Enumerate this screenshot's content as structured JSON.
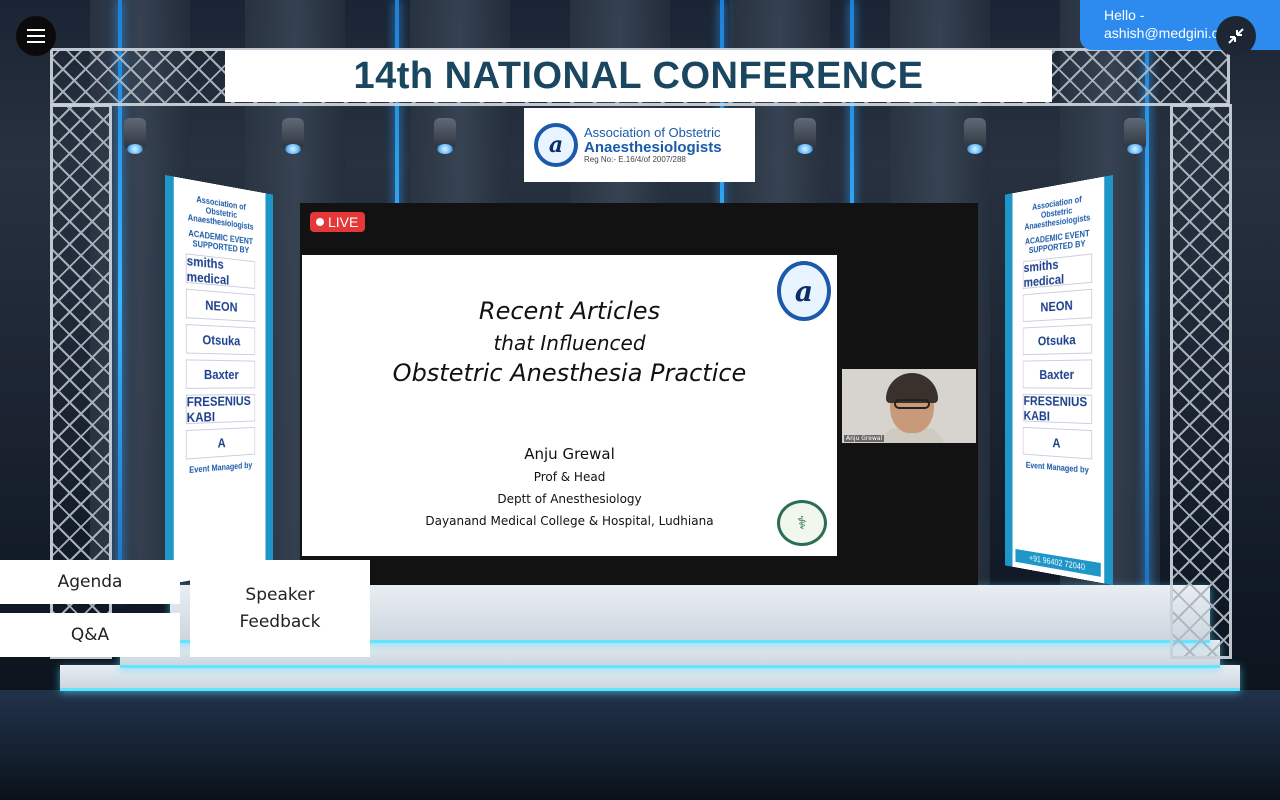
{
  "header": {
    "greeting": "Hello -",
    "email": "ashish@medgini.com"
  },
  "stage": {
    "banner_title": "14th NATIONAL CONFERENCE",
    "association": {
      "line1": "Association of Obstetric",
      "line2": "Anaesthesiologists",
      "line3": "Reg No:- E.16/4/of 2007/288",
      "logo_letter": "a"
    }
  },
  "sponsors": {
    "left": {
      "top_text": "Association of Obstetric Anaesthesiologists",
      "subtitle": "ACADEMIC EVENT SUPPORTED BY",
      "items": [
        "smiths medical",
        "NEON",
        "Otsuka",
        "Baxter",
        "FRESENIUS KABI",
        "A"
      ],
      "footer": "Event Managed by"
    },
    "right": {
      "top_text": "Association of Obstetric Anaesthesiologists",
      "subtitle": "ACADEMIC EVENT SUPPORTED BY",
      "items": [
        "smiths medical",
        "NEON",
        "Otsuka",
        "Baxter",
        "FRESENIUS KABI",
        "A"
      ],
      "footer": "Event Managed by",
      "phone": "+91 96402 72040"
    }
  },
  "video": {
    "live_label": "LIVE",
    "slide": {
      "title_line1": "Recent Articles",
      "title_line2": "that Influenced",
      "title_line3": "Obstetric Anesthesia Practice",
      "speaker": "Anju Grewal",
      "role": "Prof & Head",
      "department": "Deptt of Anesthesiology",
      "institution": "Dayanand Medical College & Hospital, Ludhiana",
      "logo_letter": "a"
    },
    "camera_label": "Anju Grewal"
  },
  "buttons": {
    "agenda": "Agenda",
    "qa": "Q&A",
    "speaker_feedback_line1": "Speaker",
    "speaker_feedback_line2": "Feedback"
  },
  "icons": {
    "menu": "hamburger-icon",
    "collapse": "collapse-icon"
  },
  "colors": {
    "banner_text": "#1a4660",
    "live_red": "#e53838",
    "hello_blue": "#2d8bf0",
    "assoc_blue": "#1b5aa8"
  }
}
